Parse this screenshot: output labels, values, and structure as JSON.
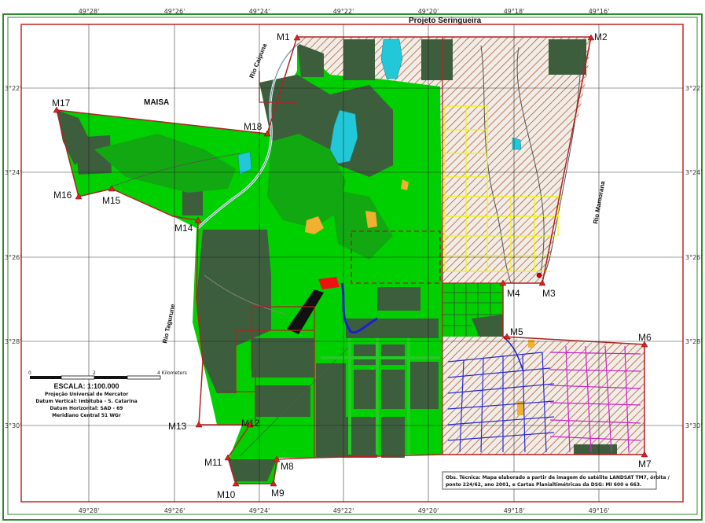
{
  "map": {
    "project_title": "Projeto Seringueira",
    "maisa_label": "MAISA",
    "top_coords": [
      "49°28'",
      "49°26'",
      "49°24'",
      "49°22'",
      "49°20'",
      "49°18'",
      "49°16'"
    ],
    "bottom_coords": [
      "49°28'",
      "49°26'",
      "49°24'",
      "49°22'",
      "49°20'",
      "49°18'",
      "49°16'"
    ],
    "left_coords": [
      "3°22'",
      "3°24'",
      "3°26'",
      "3°28'",
      "3°30'"
    ],
    "right_coords": [
      "3°22'",
      "3°24'",
      "3°26'",
      "3°28'",
      "3°30'"
    ],
    "markers": [
      "M1",
      "M2",
      "M3",
      "M4",
      "M5",
      "M6",
      "M7",
      "M8",
      "M9",
      "M10",
      "M11",
      "M12",
      "M13",
      "M14",
      "M15",
      "M16",
      "M17",
      "M18"
    ],
    "rivers": {
      "caipuna": "Rio Caipuna",
      "mamorana": "Rio Mamorana",
      "tagurune": "Rio Tagurune"
    },
    "scale": {
      "ticks": [
        "0",
        "2",
        "4 Kilometers"
      ],
      "scale_text": "ESCALA: 1:100.000",
      "projection": "Projeção Universal de Mercator",
      "datum_vertical": "Datum Vertical: Imbituba - S. Catarina",
      "datum_horizontal": "Datum Horizontal: SAD - 69",
      "meridian": "Meridiano Central 51 WGr"
    },
    "note_lines": [
      "Obs. Técnica: Mapa elaborado a partir de imagem do satélite LANDSAT TM7, órbita /",
      "ponto 224/62, ano 2001, e Cartas Planialtimétricas da DSG: MI 600 e 663."
    ],
    "colors": {
      "light_green": "#00d000",
      "bright_green": "#22dd22",
      "dark_forest": "#3d5e3d",
      "medium_green": "#11a811",
      "water": "#22c8d8",
      "boundary": "#b22222",
      "frame_green": "#2e8b2e",
      "hatch": "#a0522d",
      "yellow_grid": "#f4f400",
      "blue_grid": "#2a2ad8",
      "magenta_grid": "#cc22cc"
    }
  }
}
